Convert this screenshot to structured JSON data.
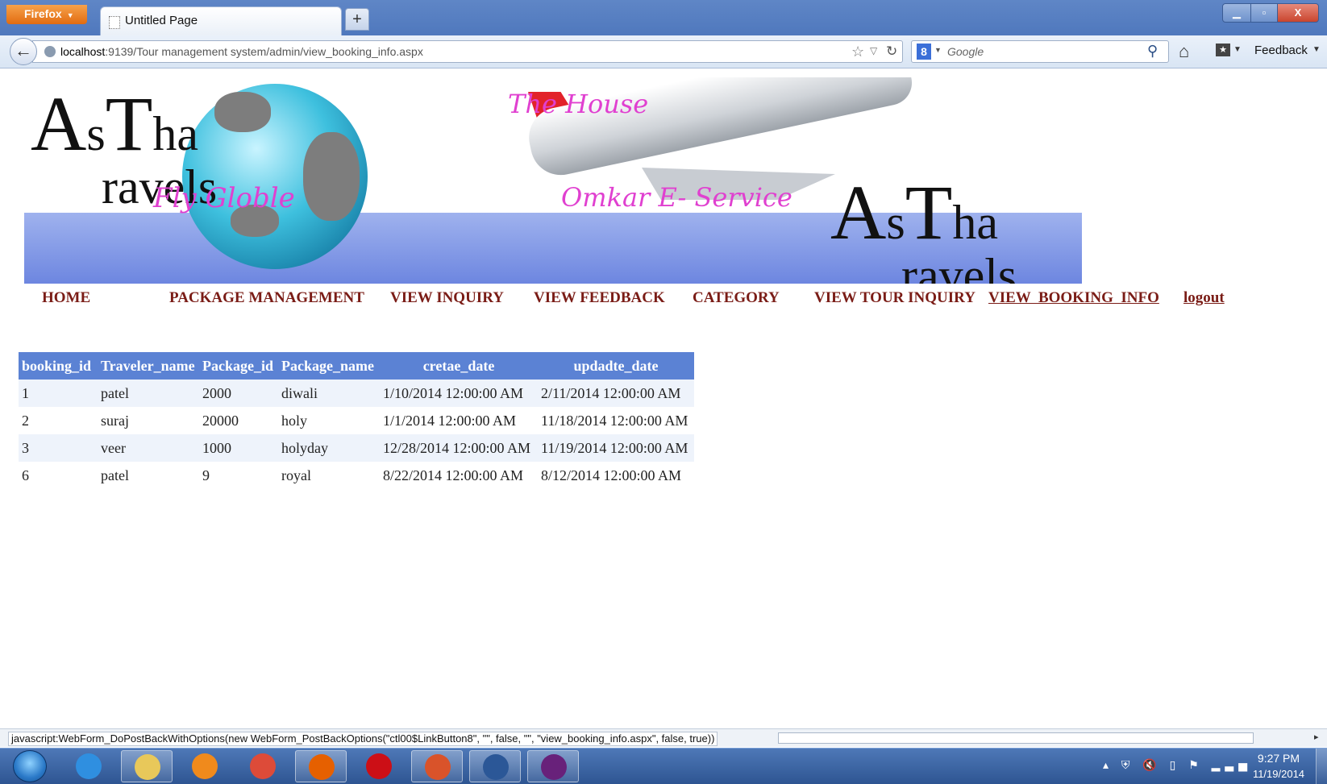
{
  "browser": {
    "menu_label": "Firefox",
    "tab_title": "Untitled Page",
    "new_tab": "+",
    "url_host": "localhost",
    "url_rest": ":9139/Tour management system/admin/view_booking_info.aspx",
    "search_placeholder": "Google",
    "search_engine_glyph": "8",
    "feedback_label": "Feedback",
    "close_glyph": "X"
  },
  "banner": {
    "logo_letters": [
      "A",
      "s",
      "T",
      "ha",
      "ravels"
    ],
    "tagline_left": "Fly Globle",
    "tagline_top": "The House",
    "tagline_bottom": "Omkar E- Service"
  },
  "nav": [
    {
      "label": "HOME",
      "active": false
    },
    {
      "label": "PACKAGE MANAGEMENT",
      "active": false
    },
    {
      "label": "VIEW INQUIRY",
      "active": false
    },
    {
      "label": "VIEW FEEDBACK",
      "active": false
    },
    {
      "label": "CATEGORY",
      "active": false
    },
    {
      "label": "VIEW TOUR INQUIRY",
      "active": false
    },
    {
      "label": "VIEW  BOOKING  INFO",
      "active": true
    },
    {
      "label": "logout",
      "active": false
    }
  ],
  "table": {
    "headers": [
      "booking_id",
      "Traveler_name",
      "Package_id",
      "Package_name",
      "cretae_date",
      "updadte_date"
    ],
    "rows": [
      [
        "1",
        "patel",
        "2000",
        "diwali",
        "1/10/2014 12:00:00 AM",
        "2/11/2014 12:00:00 AM"
      ],
      [
        "2",
        "suraj",
        "20000",
        "holy",
        "1/1/2014 12:00:00 AM",
        "11/18/2014 12:00:00 AM"
      ],
      [
        "3",
        "veer",
        "1000",
        "holyday",
        "12/28/2014 12:00:00 AM",
        "11/19/2014 12:00:00 AM"
      ],
      [
        "6",
        "patel",
        "9",
        "royal",
        "8/22/2014 12:00:00 AM",
        "8/12/2014 12:00:00 AM"
      ]
    ]
  },
  "status_bar": "javascript:WebForm_DoPostBackWithOptions(new WebForm_PostBackOptions(\"ctl00$LinkButton8\", \"\", false, \"\", \"view_booking_info.aspx\", false, true))",
  "taskbar": {
    "apps": [
      {
        "name": "internet-explorer",
        "color": "#2f8fe0",
        "open": false
      },
      {
        "name": "file-explorer",
        "color": "#e8c85a",
        "open": true
      },
      {
        "name": "media-player",
        "color": "#f08a1c",
        "open": false
      },
      {
        "name": "chrome",
        "color": "#dd4b39",
        "open": false
      },
      {
        "name": "firefox",
        "color": "#e66000",
        "open": true
      },
      {
        "name": "opera",
        "color": "#cc0f16",
        "open": false
      },
      {
        "name": "presentation-app",
        "color": "#d9532a",
        "open": true
      },
      {
        "name": "word",
        "color": "#2b5797",
        "open": true
      },
      {
        "name": "visual-studio",
        "color": "#68217a",
        "open": true
      }
    ],
    "time": "9:27 PM",
    "date": "11/19/2014",
    "tray_glyphs": "▴ ⛨ 🔇 ▯ ⚑ ▂▃▅"
  }
}
